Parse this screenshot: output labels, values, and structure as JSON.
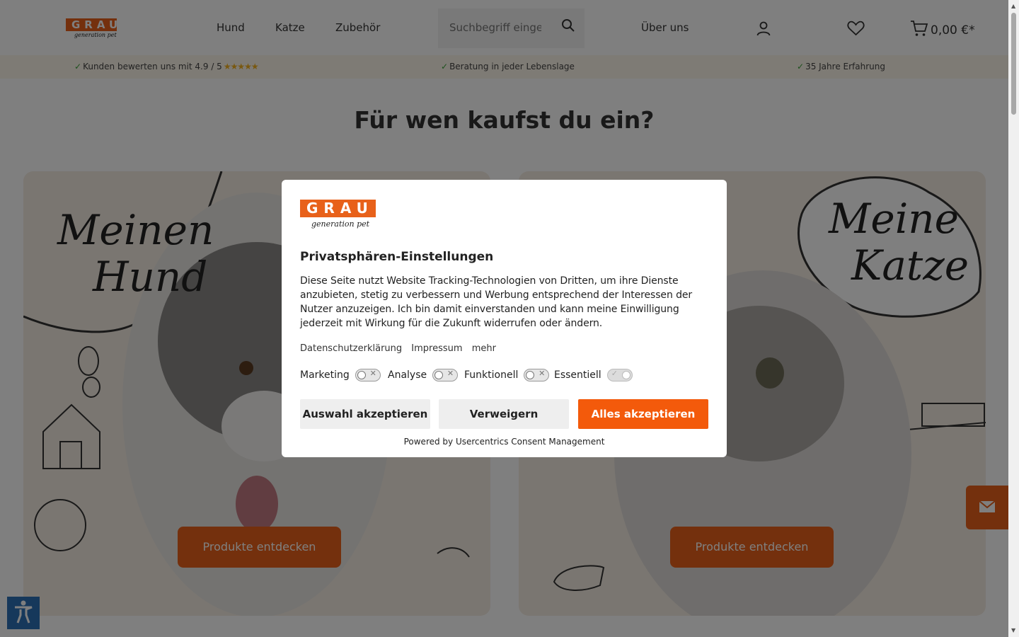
{
  "header": {
    "logo_text": "GRAU",
    "logo_sub": "generation pet",
    "nav": [
      "Hund",
      "Katze",
      "Zubehör"
    ],
    "search_placeholder": "Suchbegriff eingeben",
    "about": "Über uns",
    "cart_total": "0,00 €*"
  },
  "usp": {
    "rating": "Kunden bewerten uns mit 4.9 / 5",
    "rating_stars": "★★★★★",
    "advice": "Beratung in jeder Lebenslage",
    "experience": "35 Jahre Erfahrung"
  },
  "main": {
    "heading": "Für wen kaufst du ein?",
    "dog_card": {
      "script": [
        "Meinen",
        "Hund"
      ],
      "cta": "Produkte entdecken"
    },
    "cat_card": {
      "script": [
        "Meine",
        "Katze"
      ],
      "cta": "Produkte entdecken"
    }
  },
  "consent": {
    "logo_text": "GRAU",
    "logo_sub": "generation pet",
    "title": "Privatsphären-Einstellungen",
    "text": "Diese Seite nutzt Website Tracking-Technologien von Dritten, um ihre Dienste anzubieten, stetig zu verbessern und Werbung entsprechend der Interessen der Nutzer anzuzeigen. Ich bin damit einverstanden und kann meine Einwilligung jederzeit mit Wirkung für die Zukunft widerrufen oder ändern.",
    "links": [
      "Datenschutzerklärung",
      "Impressum",
      "mehr"
    ],
    "toggles": [
      {
        "label": "Marketing",
        "on": false
      },
      {
        "label": "Analyse",
        "on": false
      },
      {
        "label": "Funktionell",
        "on": false
      },
      {
        "label": "Essentiell",
        "on": true
      }
    ],
    "buttons": [
      "Auswahl akzeptieren",
      "Verweigern",
      "Alles akzeptieren"
    ],
    "powered": "Powered by Usercentrics Consent Management"
  },
  "colors": {
    "brand_orange": "#e8611a",
    "accept_orange": "#f35a0b",
    "a11y_blue": "#2d70b6"
  }
}
